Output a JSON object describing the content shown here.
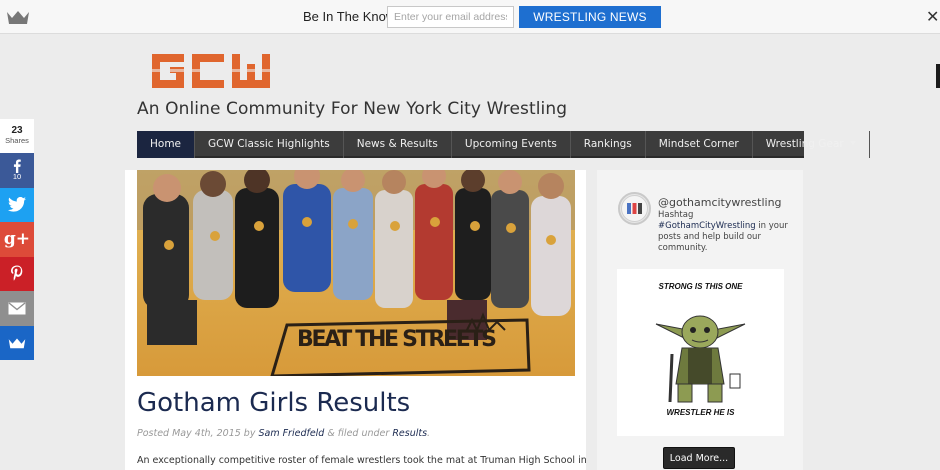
{
  "topbar": {
    "label": "Be In The Know",
    "email_placeholder": "Enter your email address",
    "button_label": "WRESTLING NEWS",
    "close_glyph": "✕"
  },
  "site": {
    "logo_text": "GCW",
    "tagline": "An Online Community For New York City Wrestling",
    "brand_color": "#e0662e"
  },
  "nav": {
    "items": [
      {
        "label": "Home",
        "active": true
      },
      {
        "label": "GCW Classic Highlights"
      },
      {
        "label": "News & Results"
      },
      {
        "label": "Upcoming Events"
      },
      {
        "label": "Rankings"
      },
      {
        "label": "Mindset Corner"
      },
      {
        "label": "Wrestling Gear",
        "has_dropdown": true
      }
    ]
  },
  "share": {
    "count": "23",
    "count_label": "Shares",
    "facebook_count": "10",
    "buttons": [
      "facebook-icon",
      "twitter-icon",
      "google-plus-icon",
      "pinterest-icon",
      "email-icon",
      "more-icon"
    ],
    "google_plus_text": "g+"
  },
  "post": {
    "hero_banner_text": "BEAT THE STREETS",
    "title": "Gotham Girls Results",
    "meta_prefix": "Posted May 4th, 2015 by ",
    "author": "Sam Friedfeld",
    "meta_middle": " & filed under ",
    "category": "Results",
    "meta_suffix": ".",
    "excerpt": "An exceptionally competitive roster of female wrestlers took the mat at Truman High School in"
  },
  "sidebar": {
    "handle": "@gothamcitywrestling",
    "bio_line1": "Hashtag",
    "bio_tag": "#GothamCityWrestling",
    "bio_rest": " in your posts and help build our community.",
    "image_top_text": "STRONG IS THIS ONE",
    "image_bottom_text": "WRESTLER HE IS",
    "load_more": "Load More..."
  }
}
